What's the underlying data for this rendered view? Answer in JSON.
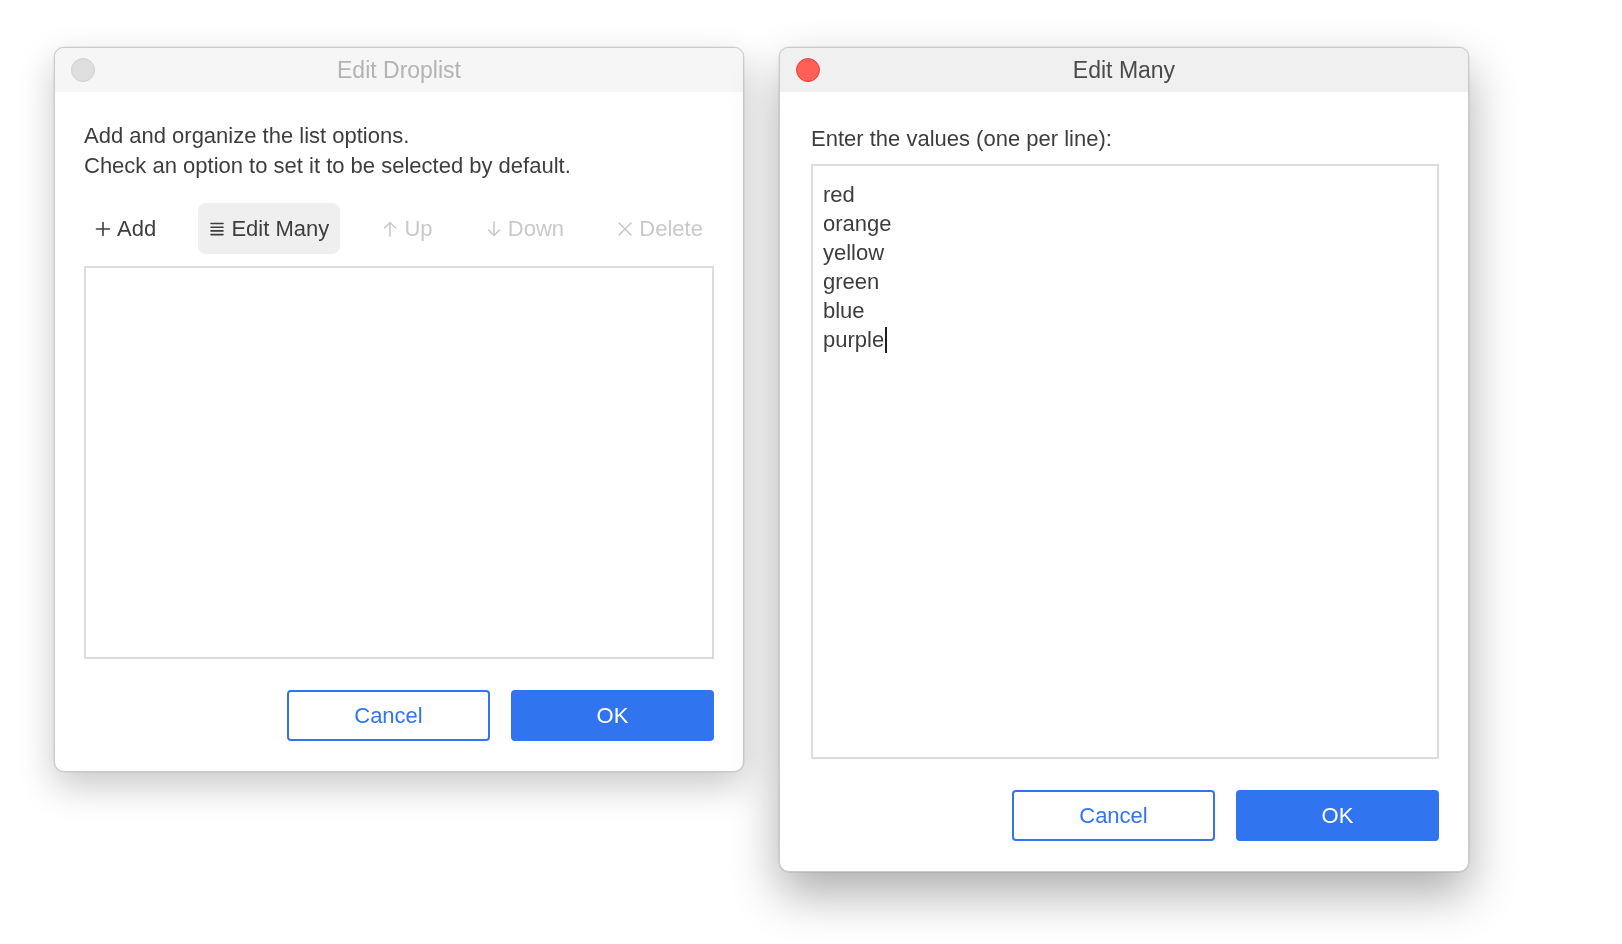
{
  "windows": [
    {
      "kind": "list_editor",
      "title": "Edit Droplist",
      "active": false,
      "description": "Add and organize the list options.\nCheck an option to set it to be selected by default.",
      "toolbar": [
        {
          "kind": "add",
          "label": "Add",
          "selected": false,
          "disabled": false
        },
        {
          "kind": "edit_many",
          "label": "Edit Many",
          "selected": true,
          "disabled": false
        },
        {
          "kind": "up",
          "label": "Up",
          "selected": false,
          "disabled": true
        },
        {
          "kind": "down",
          "label": "Down",
          "selected": false,
          "disabled": true
        },
        {
          "kind": "delete",
          "label": "Delete",
          "selected": false,
          "disabled": true
        }
      ],
      "buttons": [
        {
          "kind": "secondary",
          "label": "Cancel"
        },
        {
          "kind": "primary",
          "label": "OK"
        }
      ]
    },
    {
      "kind": "text_entry",
      "title": "Edit Many",
      "active": true,
      "prompt": "Enter the values (one per line):",
      "field": {
        "value": "red\norange\nyellow\ngreen\nblue\npurple",
        "focused": true
      },
      "buttons": [
        {
          "kind": "secondary",
          "label": "Cancel"
        },
        {
          "kind": "primary",
          "label": "OK"
        }
      ]
    }
  ]
}
